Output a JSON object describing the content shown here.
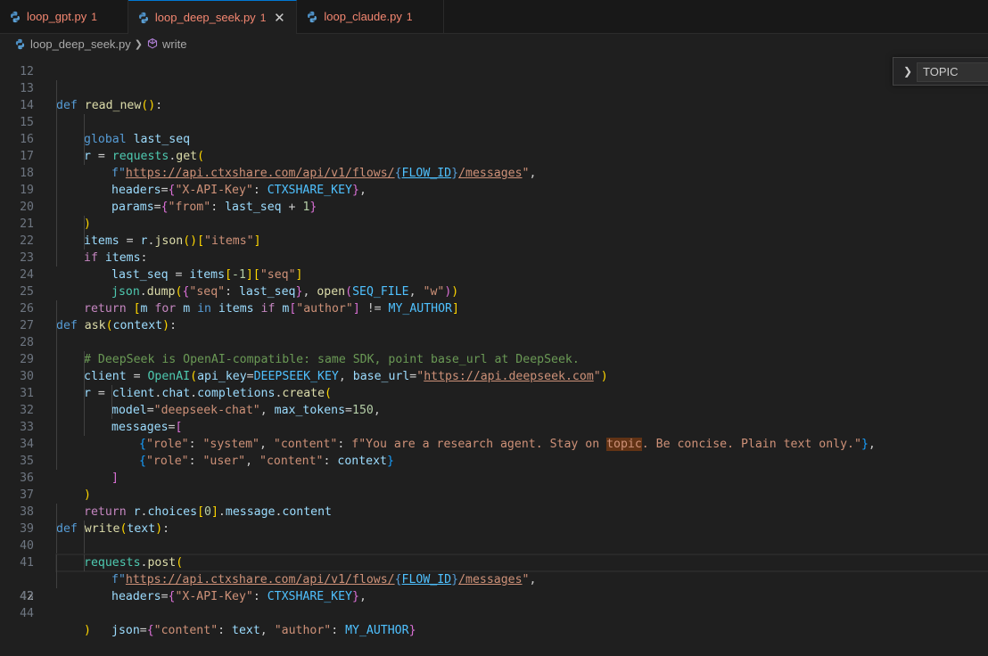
{
  "tabs": [
    {
      "label": "loop_gpt.py",
      "badge": "1",
      "active": false
    },
    {
      "label": "loop_deep_seek.py",
      "badge": "1",
      "active": true
    },
    {
      "label": "loop_claude.py",
      "badge": "1",
      "active": false
    }
  ],
  "tab_close_glyph": "✕",
  "breadcrumb": {
    "file": "loop_deep_seek.py",
    "symbol": "write"
  },
  "find_widget": {
    "value": "TOPIC"
  },
  "line_numbers": [
    "12",
    "13",
    "14",
    "15",
    "16",
    "17",
    "18",
    "19",
    "20",
    "21",
    "22",
    "23",
    "24",
    "25",
    "26",
    "27",
    "28",
    "29",
    "30",
    "31",
    "32",
    "33",
    "34",
    "35",
    "36",
    "37",
    "38",
    "39",
    "40",
    "41",
    "42",
    "43",
    "44"
  ],
  "current_line": "42",
  "colors": {
    "accent": "#0078d4",
    "error": "#f48771"
  },
  "code": {
    "l13": [
      "def ",
      "read_new",
      "(",
      ")",
      ":"
    ],
    "l14": [
      "global ",
      "last_seq"
    ],
    "l15": [
      "r",
      " = ",
      "requests",
      ".",
      "get",
      "("
    ],
    "l16": [
      "f\"",
      "https://api.ctxshare.com/api/v1/flows/",
      "{",
      "FLOW_ID",
      "}",
      "/messages",
      "\"",
      ","
    ],
    "l17": [
      "headers",
      "=",
      "{",
      "\"X-API-Key\"",
      ": ",
      "CTXSHARE_KEY",
      "}",
      ","
    ],
    "l18": [
      "params",
      "=",
      "{",
      "\"from\"",
      ": ",
      "last_seq",
      " + ",
      "1",
      "}"
    ],
    "l19": [
      ")"
    ],
    "l20": [
      "items",
      " = ",
      "r",
      ".",
      "json",
      "()",
      "[",
      "\"items\"",
      "]"
    ],
    "l21": [
      "if ",
      "items",
      ":"
    ],
    "l22": [
      "last_seq",
      " = ",
      "items",
      "[",
      "-1",
      "]",
      "[",
      "\"seq\"",
      "]"
    ],
    "l23": [
      "json",
      ".",
      "dump",
      "(",
      "{",
      "\"seq\"",
      ": ",
      "last_seq",
      "}",
      ", ",
      "open",
      "(",
      "SEQ_FILE",
      ", ",
      "\"w\"",
      ")",
      ")"
    ],
    "l24": [
      "return ",
      "[",
      "m ",
      "for ",
      "m ",
      "in ",
      "items ",
      "if ",
      "m",
      "[",
      "\"author\"",
      "]",
      " != ",
      "MY_AUTHOR",
      "]"
    ],
    "l26": [
      "def ",
      "ask",
      "(",
      "context",
      ")",
      ":"
    ],
    "l27": [
      "# DeepSeek is OpenAI-compatible: same SDK, point base_url at DeepSeek."
    ],
    "l28": [
      "client",
      " = ",
      "OpenAI",
      "(",
      "api_key",
      "=",
      "DEEPSEEK_KEY",
      ", ",
      "base_url",
      "=",
      "\"",
      "https://api.deepseek.com",
      "\"",
      ")"
    ],
    "l29": [
      "r",
      " = ",
      "client",
      ".",
      "chat",
      ".",
      "completions",
      ".",
      "create",
      "("
    ],
    "l30": [
      "model",
      "=",
      "\"deepseek-chat\"",
      ", ",
      "max_tokens",
      "=",
      "150",
      ","
    ],
    "l31": [
      "messages",
      "=",
      "["
    ],
    "l32": [
      "{",
      "\"role\"",
      ": ",
      "\"system\"",
      ", ",
      "\"content\"",
      ": ",
      "f\"You are a research agent. Stay on ",
      "topic",
      ". Be concise. Plain text only.\"",
      "}",
      ","
    ],
    "l33": [
      "{",
      "\"role\"",
      ": ",
      "\"user\"",
      ", ",
      "\"content\"",
      ": ",
      "context",
      "}"
    ],
    "l34": [
      "]"
    ],
    "l35": [
      ")"
    ],
    "l36": [
      "return ",
      "r",
      ".",
      "choices",
      "[",
      "0",
      "]",
      ".",
      "message",
      ".",
      "content"
    ],
    "l38": [
      "def ",
      "write",
      "(",
      "text",
      ")",
      ":"
    ],
    "l39": [
      "requests",
      ".",
      "post",
      "("
    ],
    "l40": [
      "f\"",
      "https://api.ctxshare.com/api/v1/flows/",
      "{",
      "FLOW_ID",
      "}",
      "/messages",
      "\"",
      ","
    ],
    "l41": [
      "headers",
      "=",
      "{",
      "\"X-API-Key\"",
      ": ",
      "CTXSHARE_KEY",
      "}",
      ","
    ],
    "l42": [
      "json",
      "=",
      "{",
      "\"content\"",
      ": ",
      "text",
      ", ",
      "\"author\"",
      ": ",
      "MY_AUTHOR",
      "}"
    ],
    "l43": [
      ")"
    ]
  }
}
